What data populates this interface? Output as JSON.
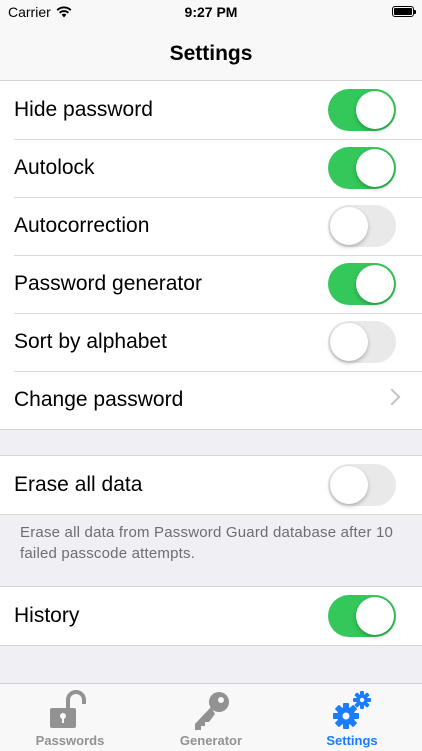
{
  "status": {
    "carrier": "Carrier",
    "time": "9:27 PM"
  },
  "nav": {
    "title": "Settings"
  },
  "groups": [
    {
      "rows": [
        {
          "label": "Hide password",
          "type": "toggle",
          "on": true
        },
        {
          "label": "Autolock",
          "type": "toggle",
          "on": true
        },
        {
          "label": "Autocorrection",
          "type": "toggle",
          "on": false
        },
        {
          "label": "Password generator",
          "type": "toggle",
          "on": true
        },
        {
          "label": "Sort by alphabet",
          "type": "toggle",
          "on": false
        },
        {
          "label": "Change password",
          "type": "disclosure"
        }
      ]
    },
    {
      "rows": [
        {
          "label": "Erase all data",
          "type": "toggle",
          "on": false
        }
      ],
      "footer": "Erase all data from Password Guard database after 10 failed passcode attempts."
    },
    {
      "rows": [
        {
          "label": "History",
          "type": "toggle",
          "on": true
        }
      ]
    }
  ],
  "tabs": [
    {
      "label": "Passwords",
      "icon": "unlocked-padlock-icon",
      "active": false
    },
    {
      "label": "Generator",
      "icon": "key-icon",
      "active": false
    },
    {
      "label": "Settings",
      "icon": "gears-icon",
      "active": true
    }
  ],
  "colors": {
    "toggle_on": "#34c759",
    "toggle_off": "#e9e9ea",
    "tint": "#1a7cff",
    "tab_inactive": "#929292"
  }
}
